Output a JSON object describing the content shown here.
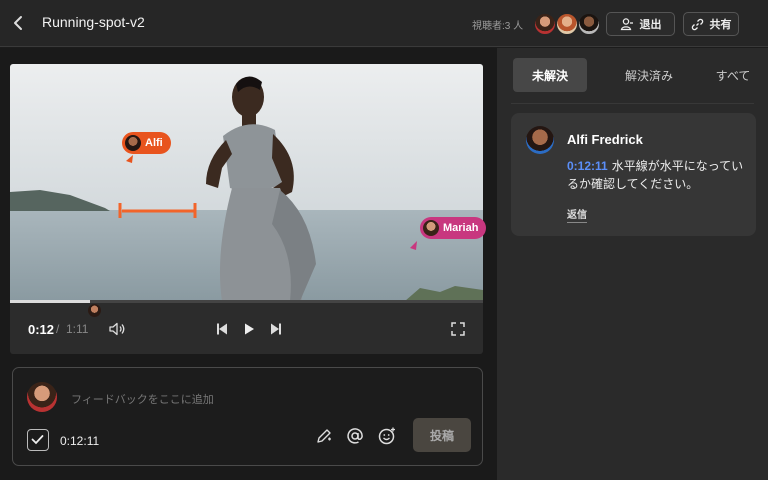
{
  "header": {
    "title": "Running-spot-v2",
    "viewers_label": "視聴者:3 人",
    "exit_label": "退出",
    "share_label": "共有"
  },
  "player": {
    "current_time": "0:12",
    "separator": "/",
    "total_time": "1:11",
    "progress": 0.17
  },
  "annotations": [
    {
      "name": "Alfi",
      "color": "#e8541e"
    },
    {
      "name": "Mariah",
      "color": "#c8377f"
    }
  ],
  "composer": {
    "placeholder": "フィードバックをここに追加",
    "timestamp": "0:12:11",
    "post_label": "投稿"
  },
  "comments_panel": {
    "tabs": [
      "未解決",
      "解決済み",
      "すべて"
    ],
    "active_tab": "未解決",
    "comments": [
      {
        "author": "Alfi Fredrick",
        "timestamp": "0:12:11",
        "text": "水平線が水平になっているか確認してください。",
        "reply_label": "返信"
      }
    ]
  },
  "colors": {
    "accent_link": "#5b8ff9",
    "annotation_line": "#f2642a"
  }
}
